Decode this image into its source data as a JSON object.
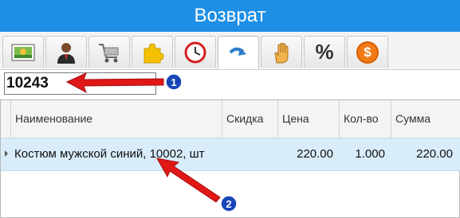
{
  "window": {
    "title": "Возврат"
  },
  "toolbar": {
    "tabs": [
      {
        "icon": "picture-icon"
      },
      {
        "icon": "user-icon"
      },
      {
        "icon": "shopping-cart-icon"
      },
      {
        "icon": "puzzle-icon"
      },
      {
        "icon": "clock-icon"
      },
      {
        "icon": "redo-arrow-icon"
      },
      {
        "icon": "hand-icon"
      },
      {
        "icon": "percent-icon",
        "label": "%"
      },
      {
        "icon": "dollar-coin-icon",
        "label": "$"
      }
    ]
  },
  "search": {
    "value": "10243"
  },
  "grid": {
    "columns": [
      "Наименование",
      "Скидка",
      "Цена",
      "Кол-во",
      "Сумма"
    ],
    "rows": [
      {
        "name": "Костюм мужской синий, 10002, шт",
        "discount": "",
        "price": "220.00",
        "qty": "1.000",
        "sum": "220.00"
      }
    ]
  },
  "annotations": [
    {
      "label": "1"
    },
    {
      "label": "2"
    }
  ],
  "colors": {
    "title_bar": "#1f8fe6",
    "selected_row": "#d8ecf9",
    "arrow": "#e01818",
    "badge": "#1846b8"
  }
}
